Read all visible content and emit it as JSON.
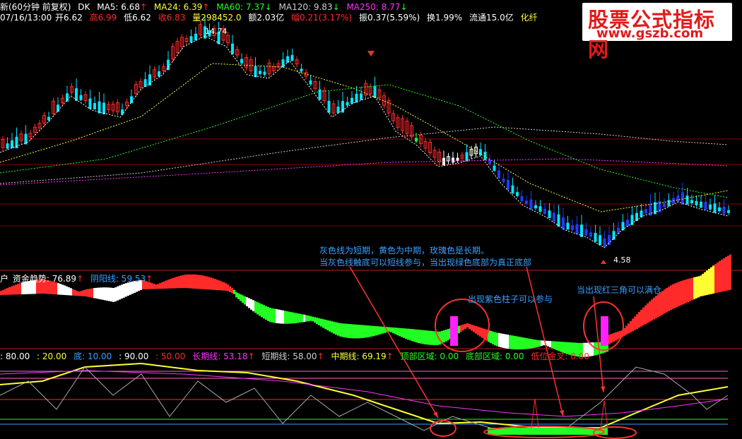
{
  "header": {
    "period": "新(60分钟 前复权)",
    "dk": "DK",
    "ma5": "MA5: 6.68",
    "ma24": "MA24: 6.39",
    "ma60": "MA60: 7.37",
    "ma120": "MA120: 9.83",
    "ma250": "MA250: 8.77",
    "info_date": "07/16/13:00",
    "open": "开6.62",
    "high": "高6.99",
    "low": "低6.62",
    "close": "收6.83",
    "volume": "量298452.0",
    "amount": "额2.03亿",
    "change": "幅0.21(3.17%)",
    "amplitude": "振0.37(5.59%)",
    "turnover": "换1.99%",
    "float": "流通15.0亿",
    "sector": "化纤",
    "price_high": "14.74",
    "price_low": "4.58"
  },
  "watermark": {
    "title": "股票公式指标网",
    "url": "www.gszb.com"
  },
  "panel2": {
    "prefix": "户",
    "fund_trend": "资金趋势: 76.89",
    "yinyang": "阴阳线: 59.53"
  },
  "panel3": {
    "v80": ": 80.00",
    "v20": ": 20.00",
    "bottom": "底: 10.00",
    "v90": ": 90.00",
    "v50": ": 50.00",
    "long_line": "长期线: 53.18",
    "short_line": "短期线: 58.00",
    "mid_line": "中期线: 69.19",
    "top_area": "顶部区域: 0.00",
    "bottom_area": "底部区域: 0.00",
    "low_cross": "低位金叉: 0.00"
  },
  "annotations": {
    "note1": "灰色线为短期，黄色为中期，玫瑰色是长期。",
    "note2": "当灰色线触底可以短线参与，当出现绿色底部为真正底部",
    "note3": "出现紫色柱子可以参与",
    "note4": "当出现红三角可以满仓"
  },
  "colors": {
    "up": "#ff2a2a",
    "down": "#00e5ff",
    "green": "#22ff22",
    "purple": "#ff22ff",
    "yellow": "#ffff33"
  }
}
